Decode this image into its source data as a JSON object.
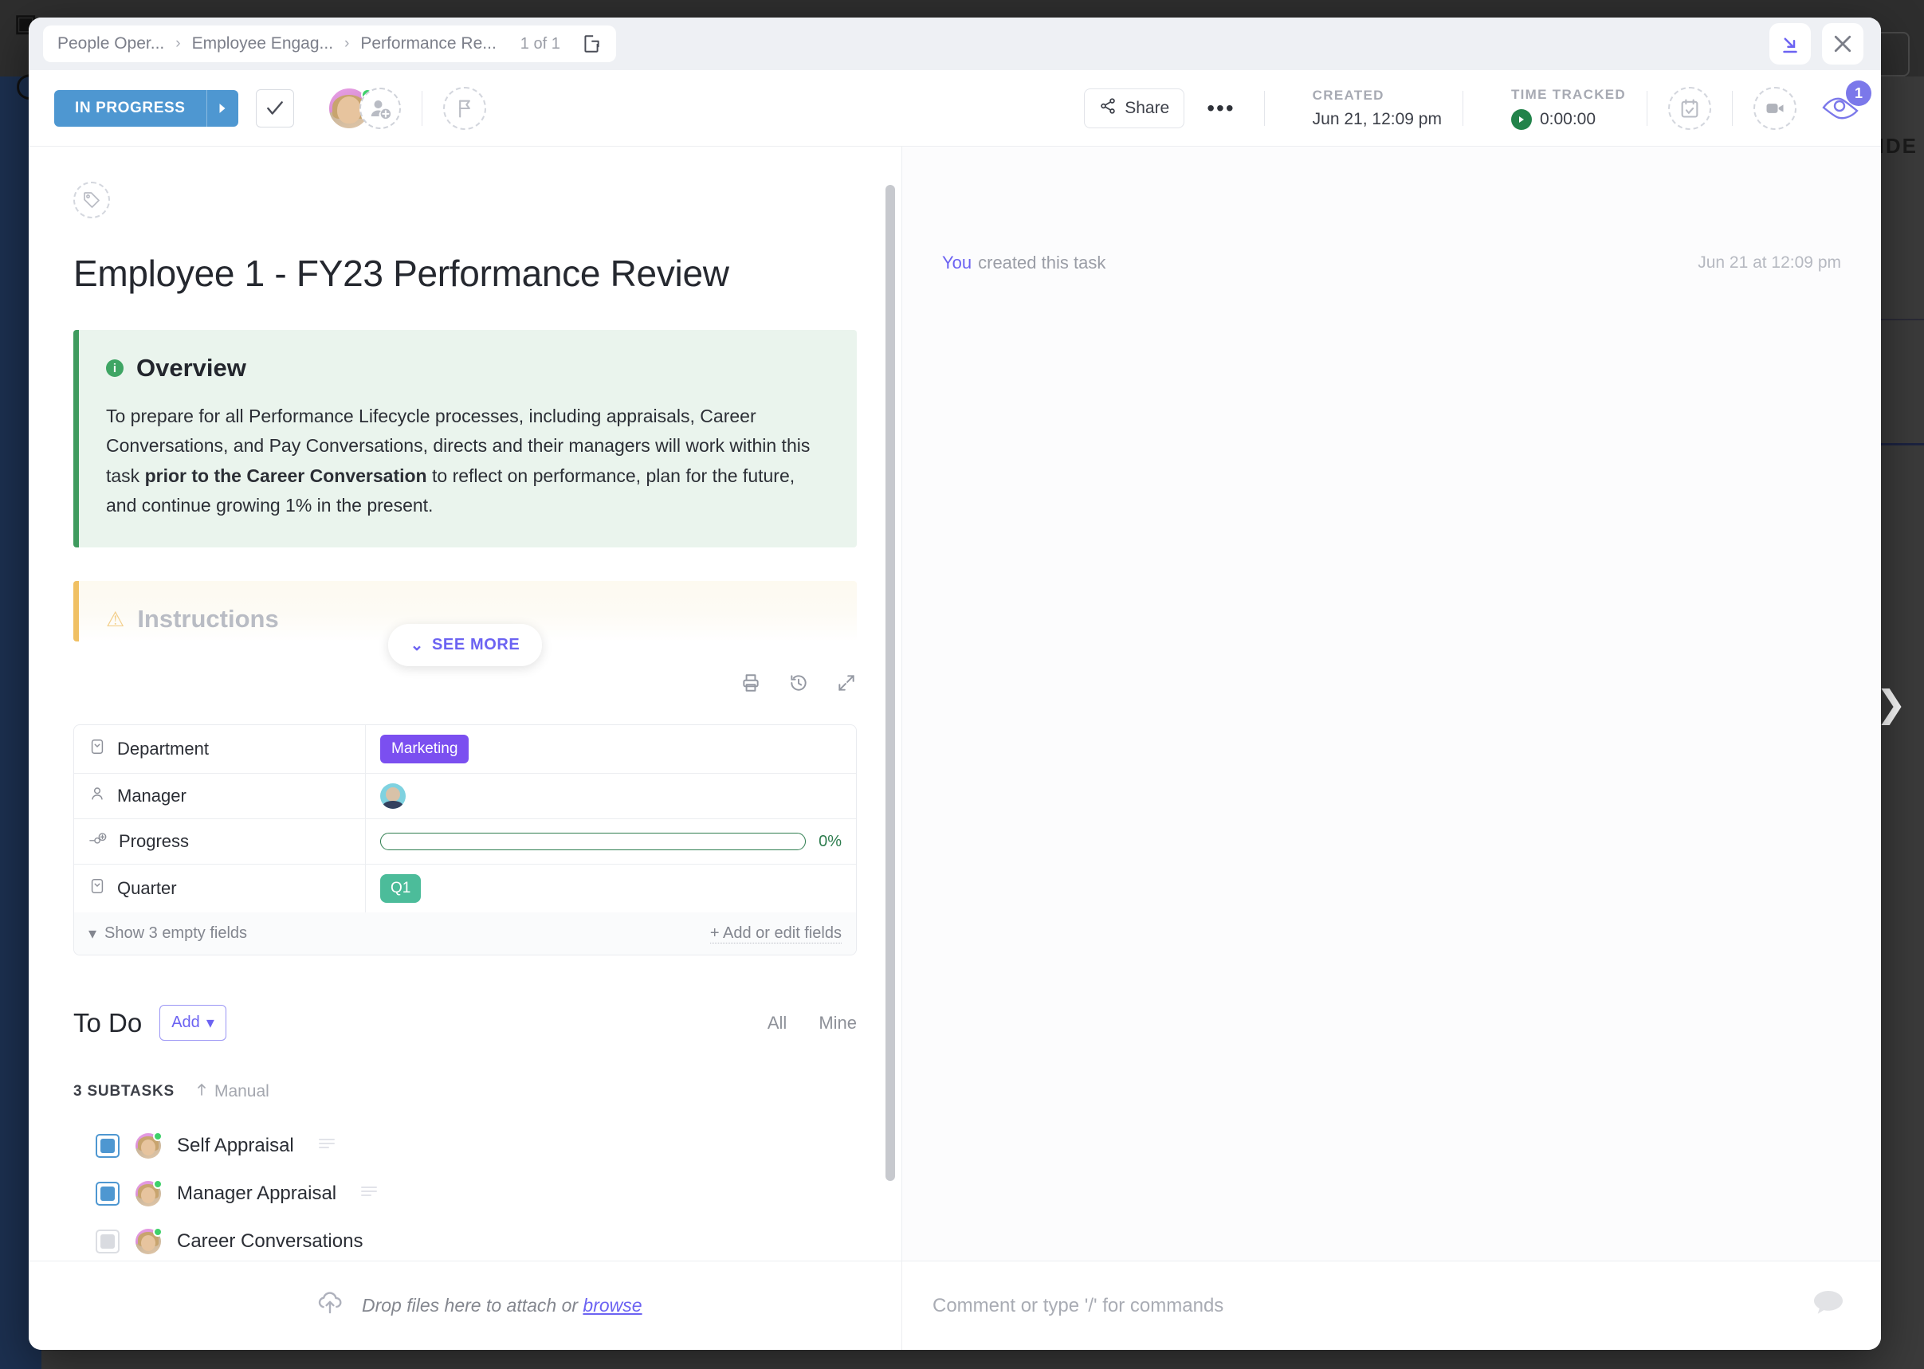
{
  "backdrop": {
    "hide_label": "HIDE",
    "right_chevron": "❯"
  },
  "breadcrumb": {
    "items": [
      "People Oper...",
      "Employee Engag...",
      "Performance Re..."
    ],
    "separator": "›",
    "count": "1 of 1",
    "open_icon": "open-task-icon"
  },
  "window_controls": {
    "minimize_icon": "minimize-to-corner-icon",
    "close_icon": "close-icon"
  },
  "toolbar": {
    "status": "IN PROGRESS",
    "status_color": "#4e97d1",
    "status_caret_icon": "chevron-right-icon",
    "complete_icon": "checkmark-icon",
    "add_assignee_icon": "add-person-icon",
    "flag_icon": "priority-flag-icon",
    "share_label": "Share",
    "share_icon": "share-icon",
    "more_label": "•••",
    "created_label": "CREATED",
    "created_value": "Jun 21, 12:09 pm",
    "time_tracked_label": "TIME TRACKED",
    "time_tracked_value": "0:00:00",
    "timer_icon": "play-icon",
    "date_icon": "calendar-check-icon",
    "record_icon": "video-camera-icon",
    "watchers_icon": "eye-icon",
    "watchers_count": "1",
    "watchers_badge_color": "#7b78ea"
  },
  "task": {
    "tag_icon": "tag-icon",
    "title": "Employee 1 - FY23 Performance Review"
  },
  "overview": {
    "icon": "info-icon",
    "title": "Overview",
    "accent_color": "#3f9b5e",
    "body_part1": "To prepare for all Performance Lifecycle processes, including appraisals, Career Conversations, and Pay Conversations, directs and their managers will work within this task ",
    "body_bold": "prior to the Career Conversation",
    "body_part2": " to reflect on performance, plan for the future, and continue growing 1% in the present."
  },
  "instructions": {
    "icon": "warning-icon",
    "title": "Instructions",
    "accent_color": "#f0c063"
  },
  "see_more": {
    "label": "SEE MORE",
    "chevron": "⌄",
    "color": "#6c63f2"
  },
  "description_tools": {
    "print_icon": "print-icon",
    "history_icon": "history-icon",
    "expand_icon": "expand-icon"
  },
  "fields": {
    "rows": [
      {
        "name": "Department",
        "icon": "dropdown-field-icon",
        "type": "chip",
        "value": "Marketing",
        "color": "#7b4ff0"
      },
      {
        "name": "Manager",
        "icon": "person-field-icon",
        "type": "avatar",
        "value": ""
      },
      {
        "name": "Progress",
        "icon": "progress-field-icon",
        "type": "progress",
        "value": "0%",
        "percent": 0,
        "color": "#2e7d4f"
      },
      {
        "name": "Quarter",
        "icon": "dropdown-field-icon",
        "type": "chip",
        "value": "Q1",
        "color": "#4cbc9a"
      }
    ],
    "show_empty_label": "Show 3 empty fields",
    "show_empty_caret": "▾",
    "add_edit_label": "+ Add or edit fields"
  },
  "todo": {
    "title": "To Do",
    "add_label": "Add",
    "add_caret": "▾",
    "tab_all": "All",
    "tab_mine": "Mine",
    "subtask_count": "3 SUBTASKS",
    "sort_label": "Manual",
    "sort_icon": "sort-arrow-up-icon",
    "subtasks": [
      {
        "name": "Self Appraisal",
        "checked": "blue",
        "has_description": true
      },
      {
        "name": "Manager Appraisal",
        "checked": "blue",
        "has_description": true
      },
      {
        "name": "Career Conversations",
        "checked": "grey",
        "has_description": false
      }
    ]
  },
  "activity": {
    "actor": "You",
    "text": "created this task",
    "timestamp": "Jun 21 at 12:09 pm"
  },
  "footer": {
    "upload_icon": "upload-cloud-icon",
    "drop_text": "Drop files here to attach or ",
    "browse_label": "browse",
    "comment_placeholder": "Comment or type '/' for commands",
    "chat_icon": "chat-bubble-icon"
  }
}
